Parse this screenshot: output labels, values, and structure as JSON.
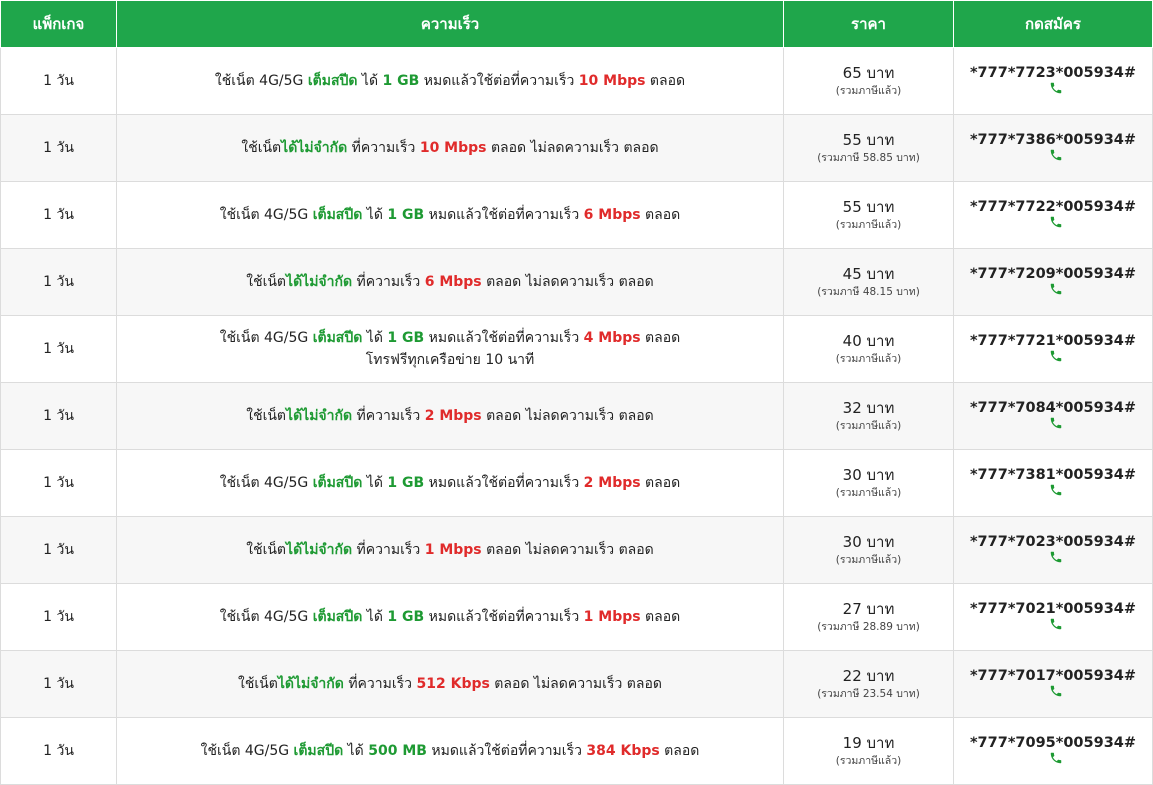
{
  "header": {
    "package": "แพ็กเกจ",
    "speed": "ความเร็ว",
    "price": "ราคา",
    "dial": "กดสมัคร"
  },
  "colors": {
    "header_bg": "#1fa64b",
    "green": "#1e9a33",
    "red": "#e02b2b"
  },
  "rows": [
    {
      "duration": "1 วัน",
      "d1": "ใช้เน็ต 4G/5G ",
      "d2": "เต็มสปีด",
      "d3": " ได้ ",
      "d4": "1 GB",
      "d5": " หมดแล้วใช้ต่อที่ความเร็ว ",
      "d6": "10 Mbps",
      "d7": " ตลอด",
      "line2": "",
      "price": "65 บาท",
      "note": "(รวมภาษีแล้ว)",
      "code": "*777*7723*005934#"
    },
    {
      "duration": "1 วัน",
      "d1": "ใช้เน็ต",
      "d2": "ได้ไม่จำกัด",
      "d3": " ที่ความเร็ว ",
      "d4": "10 Mbps",
      "d5": " ตลอด ไม่ลดความเร็ว ตลอด",
      "price": "55 บาท",
      "note": "(รวมภาษี 58.85 บาท)",
      "code": "*777*7386*005934#"
    },
    {
      "duration": "1 วัน",
      "d1": "ใช้เน็ต 4G/5G ",
      "d2": "เต็มสปีด",
      "d3": " ได้ ",
      "d4": "1 GB",
      "d5": " หมดแล้วใช้ต่อที่ความเร็ว ",
      "d6": "6 Mbps",
      "d7": " ตลอด",
      "line2": "",
      "price": "55 บาท",
      "note": "(รวมภาษีแล้ว)",
      "code": "*777*7722*005934#"
    },
    {
      "duration": "1 วัน",
      "d1": "ใช้เน็ต",
      "d2": "ได้ไม่จำกัด",
      "d3": " ที่ความเร็ว ",
      "d4": "6 Mbps",
      "d5": " ตลอด ไม่ลดความเร็ว ตลอด",
      "price": "45 บาท",
      "note": "(รวมภาษี 48.15 บาท)",
      "code": "*777*7209*005934#"
    },
    {
      "duration": "1 วัน",
      "d1": "ใช้เน็ต 4G/5G ",
      "d2": "เต็มสปีด",
      "d3": " ได้ ",
      "d4": "1 GB",
      "d5": " หมดแล้วใช้ต่อที่ความเร็ว ",
      "d6": "4 Mbps",
      "d7": " ตลอด",
      "line2": "โทรฟรีทุกเครือข่าย 10 นาที",
      "price": "40 บาท",
      "note": "(รวมภาษีแล้ว)",
      "code": "*777*7721*005934#"
    },
    {
      "duration": "1 วัน",
      "d1": "ใช้เน็ต",
      "d2": "ได้ไม่จำกัด",
      "d3": " ที่ความเร็ว ",
      "d4": "2 Mbps",
      "d5": " ตลอด ไม่ลดความเร็ว ตลอด",
      "price": "32 บาท",
      "note": "(รวมภาษีแล้ว)",
      "code": "*777*7084*005934#"
    },
    {
      "duration": "1 วัน",
      "d1": "ใช้เน็ต 4G/5G ",
      "d2": "เต็มสปีด",
      "d3": " ได้ ",
      "d4": "1 GB",
      "d5": " หมดแล้วใช้ต่อที่ความเร็ว ",
      "d6": "2 Mbps",
      "d7": " ตลอด",
      "line2": "",
      "price": "30 บาท",
      "note": "(รวมภาษีแล้ว)",
      "code": "*777*7381*005934#"
    },
    {
      "duration": "1 วัน",
      "d1": "ใช้เน็ต",
      "d2": "ได้ไม่จำกัด",
      "d3": " ที่ความเร็ว ",
      "d4": "1 Mbps",
      "d5": " ตลอด ไม่ลดความเร็ว ตลอด",
      "price": "30 บาท",
      "note": "(รวมภาษีแล้ว)",
      "code": "*777*7023*005934#"
    },
    {
      "duration": "1 วัน",
      "d1": "ใช้เน็ต 4G/5G ",
      "d2": "เต็มสปีด",
      "d3": " ได้ ",
      "d4": "1 GB",
      "d5": " หมดแล้วใช้ต่อที่ความเร็ว ",
      "d6": "1 Mbps",
      "d7": " ตลอด",
      "line2": "",
      "price": "27 บาท",
      "note": "(รวมภาษี 28.89 บาท)",
      "code": "*777*7021*005934#"
    },
    {
      "duration": "1 วัน",
      "d1": "ใช้เน็ต",
      "d2": "ได้ไม่จำกัด",
      "d3": " ที่ความเร็ว ",
      "d4": "512 Kbps",
      "d5": " ตลอด ไม่ลดความเร็ว ตลอด",
      "price": "22 บาท",
      "note": "(รวมภาษี 23.54 บาท)",
      "code": "*777*7017*005934#"
    },
    {
      "duration": "1 วัน",
      "d1": "ใช้เน็ต 4G/5G ",
      "d2": "เต็มสปีด",
      "d3": " ได้ ",
      "d4": "500 MB",
      "d5": " หมดแล้วใช้ต่อที่ความเร็ว ",
      "d6": "384 Kbps",
      "d7": " ตลอด",
      "line2": "",
      "price": "19 บาท",
      "note": "(รวมภาษีแล้ว)",
      "code": "*777*7095*005934#"
    }
  ]
}
